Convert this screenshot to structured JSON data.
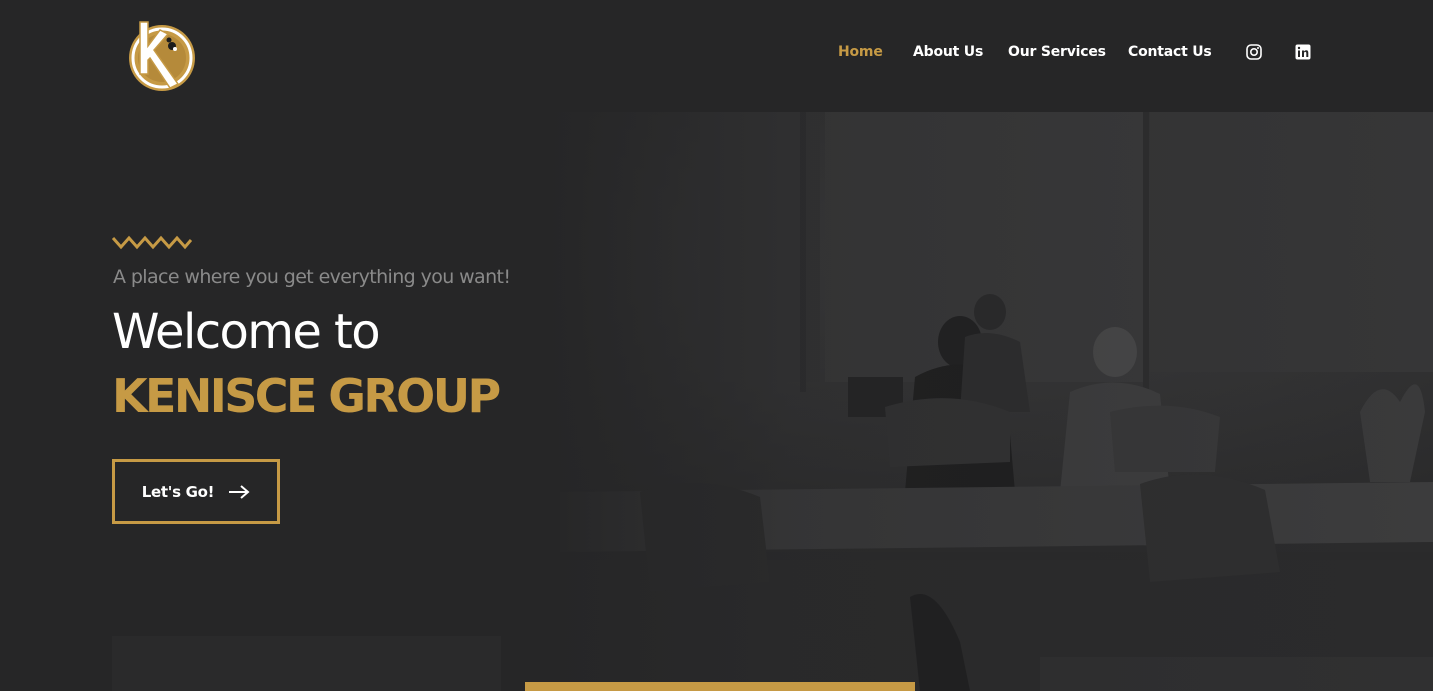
{
  "brand": {
    "logo_name": "kenisce-logo",
    "accent_color": "#c69a45"
  },
  "nav": {
    "items": [
      {
        "label": "Home",
        "active": true
      },
      {
        "label": "About Us",
        "active": false
      },
      {
        "label": "Our Services",
        "active": false
      },
      {
        "label": "Contact Us",
        "active": false
      }
    ],
    "social": [
      {
        "icon": "instagram-icon"
      },
      {
        "icon": "linkedin-icon"
      }
    ]
  },
  "hero": {
    "tagline": "A place where you get everything you want!",
    "heading": "Welcome to",
    "brand_name": "KENISCE GROUP",
    "cta_label": "Let's Go!",
    "background": "office-meeting-photo"
  },
  "colors": {
    "background": "#262627",
    "text": "#ffffff",
    "muted_text": "#8a8a8a",
    "accent": "#c69a45"
  }
}
